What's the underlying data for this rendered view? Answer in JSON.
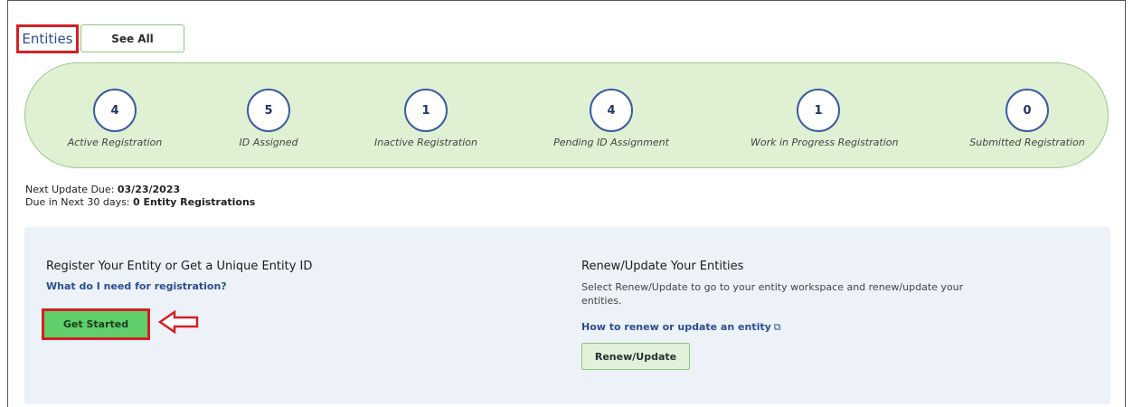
{
  "tabs": {
    "entities": "Entities",
    "see_all": "See All"
  },
  "stats": [
    {
      "value": "4",
      "label": "Active Registration"
    },
    {
      "value": "5",
      "label": "ID Assigned"
    },
    {
      "value": "1",
      "label": "Inactive Registration"
    },
    {
      "value": "4",
      "label": "Pending ID Assignment"
    },
    {
      "value": "1",
      "label": "Work in Progress Registration"
    },
    {
      "value": "0",
      "label": "Submitted Registration"
    }
  ],
  "meta": {
    "next_update_label": "Next Update Due:",
    "next_update_value": "03/23/2023",
    "due_label": "Due in Next 30 days:",
    "due_value": "0 Entity Registrations"
  },
  "register": {
    "title": "Register Your Entity or Get a Unique Entity ID",
    "link": "What do I need for registration?",
    "button": "Get Started"
  },
  "renew": {
    "title": "Renew/Update Your Entities",
    "description": "Select Renew/Update to go to your entity workspace and renew/update your entities.",
    "link": "How to renew or update an entity",
    "button": "Renew/Update"
  },
  "icons": {
    "external_link": "external-link-icon",
    "annotation_arrow": "left-arrow-icon"
  },
  "colors": {
    "highlight_border": "#d41f26",
    "pill_bg": "#dff0d3",
    "primary_button": "#5fce6b",
    "link": "#2b4e92"
  }
}
